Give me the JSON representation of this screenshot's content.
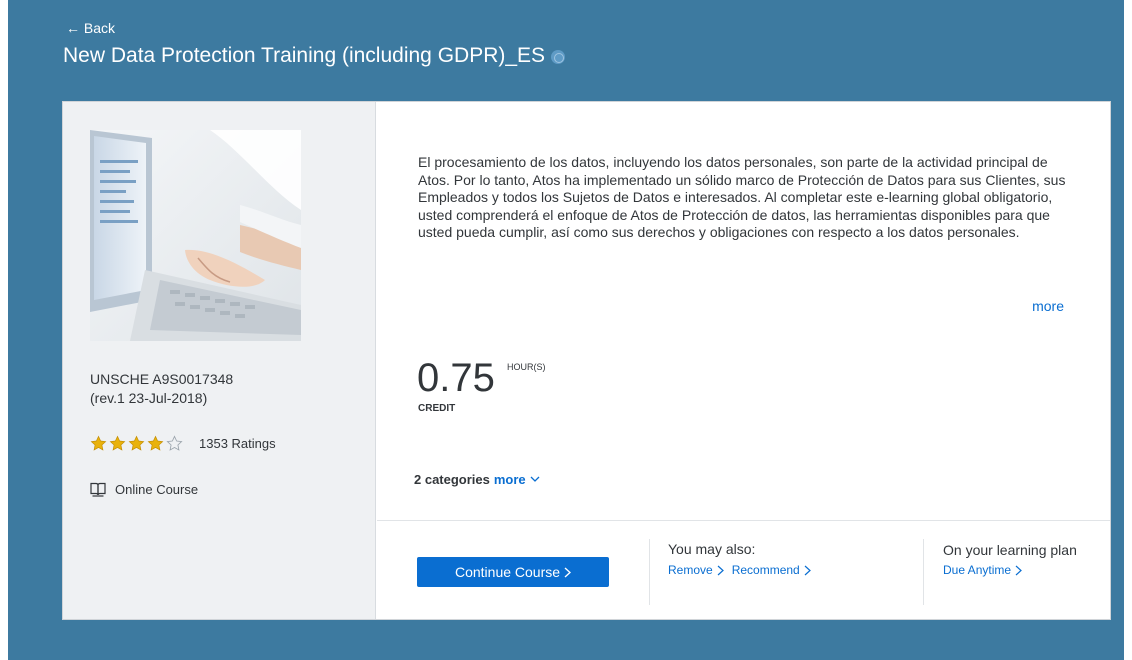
{
  "header": {
    "back_label": "← Back",
    "title": "New Data Protection Training (including GDPR)_ES"
  },
  "course": {
    "code_line1": "UNSCHE A9S0017348",
    "code_line2": "(rev.1 23-Jul-2018)",
    "rating_value": 4,
    "rating_max": 5,
    "ratings_count": "1353 Ratings",
    "format": "Online Course",
    "description": "El procesamiento de los datos, incluyendo los datos personales, son parte de la actividad principal de Atos. Por lo tanto, Atos ha implementado un sólido marco de Protección de Datos para sus Clientes, sus Empleados y todos los Sujetos de Datos e interesados. Al completar este e-learning global obligatorio, usted comprenderá el enfoque de Atos de Protección de datos, las herramientas disponibles para que usted pueda cumplir, así como sus derechos y obligaciones con respecto a los datos personales.",
    "more_label": "more",
    "credit_value": "0.75",
    "credit_unit": "HOUR(S)",
    "credit_label": "CREDIT",
    "categories_label": "2 categories",
    "categories_more": "more"
  },
  "actions": {
    "continue_label": "Continue Course",
    "also_title": "You may also:",
    "remove_label": "Remove",
    "recommend_label": "Recommend",
    "plan_title": "On your learning plan",
    "due_label": "Due Anytime"
  },
  "icons": {
    "back": "arrow-left-icon",
    "globe": "globe-icon",
    "star_full": "star-filled-icon",
    "star_empty": "star-empty-icon",
    "format": "book-icon",
    "chevron": "chevron-right-icon"
  },
  "colors": {
    "page_background": "#3d7aa0",
    "accent": "#0a6ed1",
    "star": "#e9b20c",
    "sidebar_bg": "#eff1f3"
  }
}
